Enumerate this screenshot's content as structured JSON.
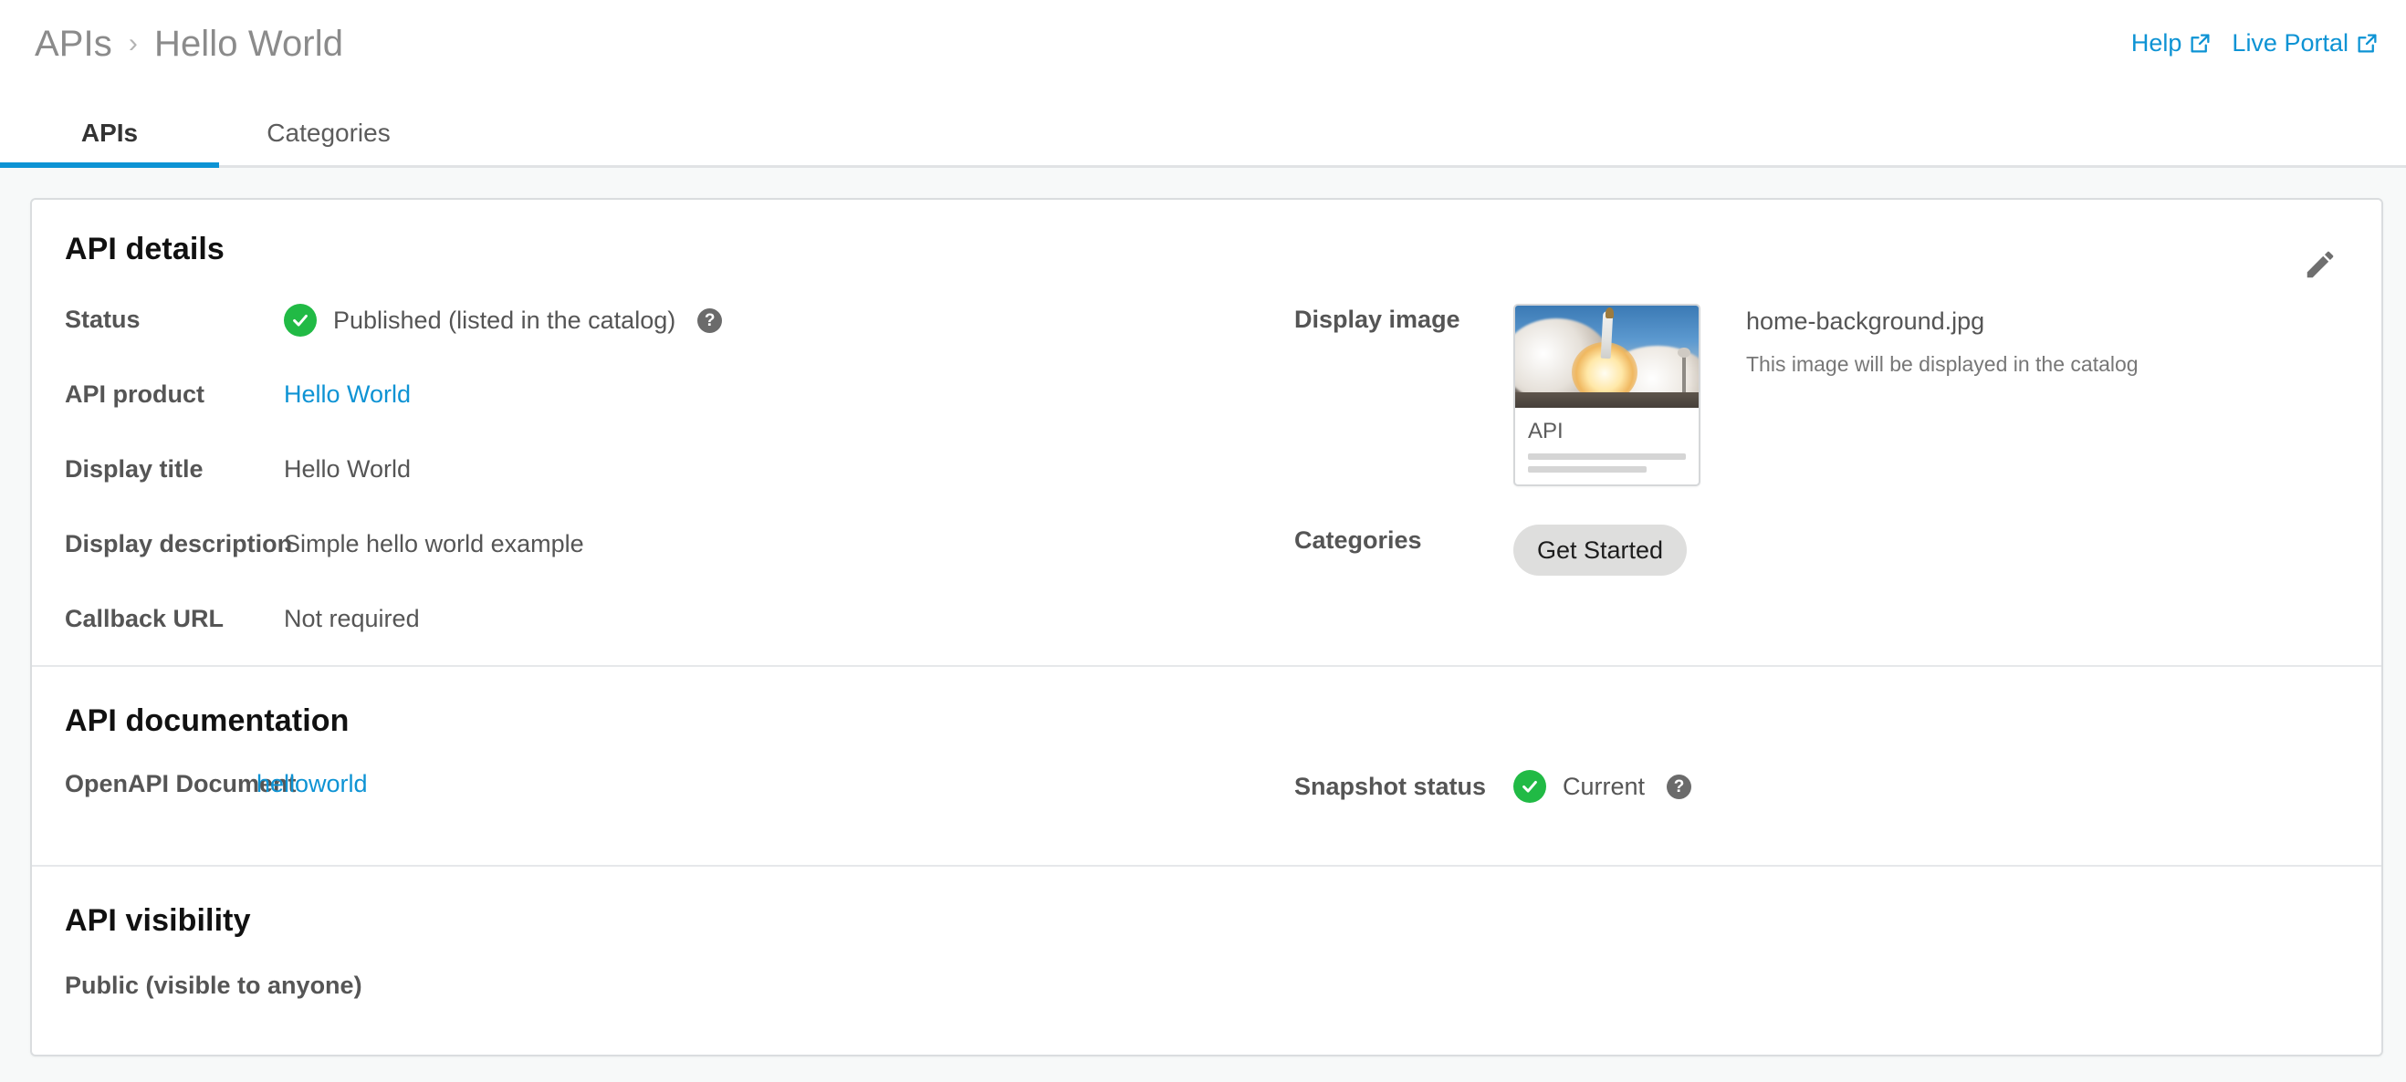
{
  "header": {
    "breadcrumb": {
      "root": "APIs",
      "separator": "›",
      "current": "Hello World"
    },
    "links": [
      {
        "label": "Help",
        "icon": "external-link-icon"
      },
      {
        "label": "Live Portal",
        "icon": "external-link-icon"
      }
    ]
  },
  "tabs": [
    {
      "label": "APIs",
      "active": true
    },
    {
      "label": "Categories",
      "active": false
    }
  ],
  "api_details": {
    "title": "API details",
    "edit_icon": "pencil-icon",
    "rows": [
      {
        "label": "Status",
        "value": "Published (listed in the catalog)",
        "status_icon": "check-circle-icon",
        "help_icon": "question-mark-icon",
        "help_glyph": "?"
      },
      {
        "label": "API product",
        "value": "Hello World",
        "is_link": true
      },
      {
        "label": "Display title",
        "value": "Hello World"
      },
      {
        "label": "Display description",
        "value": "Simple hello world example"
      },
      {
        "label": "Callback URL",
        "value": "Not required"
      }
    ],
    "display_image": {
      "label": "Display image",
      "thumbnail_title": "API",
      "file_name": "home-background.jpg",
      "hint": "This image will be displayed in the catalog"
    },
    "categories": {
      "label": "Categories",
      "chips": [
        "Get Started"
      ]
    }
  },
  "api_documentation": {
    "title": "API documentation",
    "doc_label": "OpenAPI Document",
    "doc_value": "helloworld",
    "snapshot_label": "Snapshot status",
    "snapshot_value": "Current",
    "snapshot_icon": "check-circle-icon",
    "snapshot_help_glyph": "?"
  },
  "api_visibility": {
    "title": "API visibility",
    "value": "Public (visible to anyone)"
  },
  "colors": {
    "accent_blue": "#0d93d4",
    "success_green": "#21ba45",
    "page_bg": "#f7f9f9",
    "card_border": "#dadddf",
    "label_gray": "#555555",
    "help_gray": "#6b6b6b",
    "chip_bg": "#dededd"
  }
}
